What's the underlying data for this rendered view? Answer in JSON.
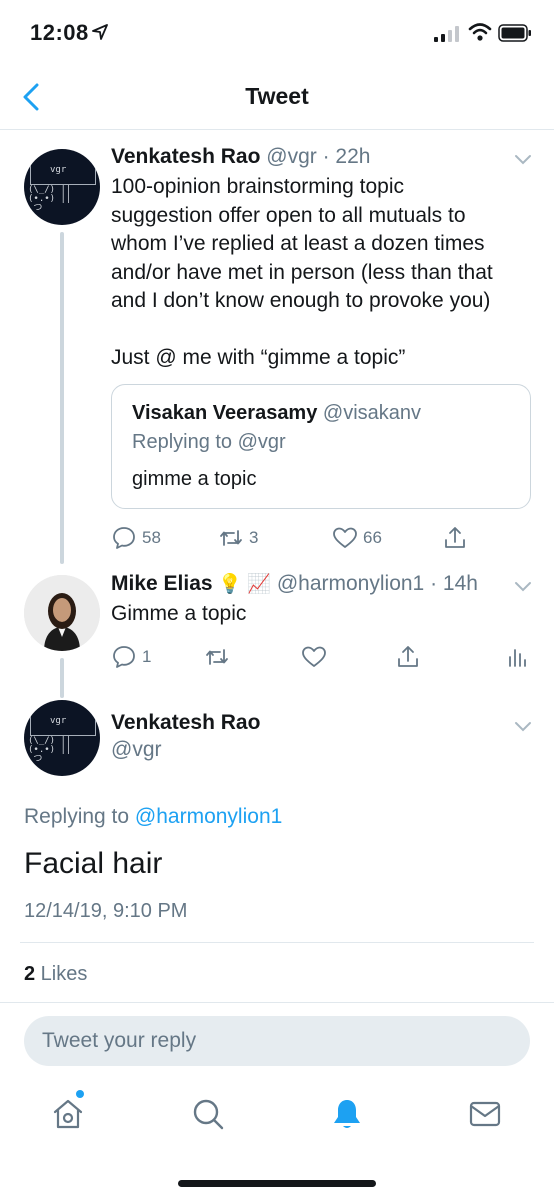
{
  "status": {
    "time": "12:08"
  },
  "nav": {
    "title": "Tweet"
  },
  "tweet1": {
    "name": "Venkatesh Rao",
    "handle_time": "@vgr · 22h",
    "avatar_text": "vgr",
    "lines": [
      "100-opinion brainstorming topic",
      "suggestion offer open to all mutuals to",
      "whom I’ve replied at least a dozen times",
      "and/or have met in person (less than that",
      "and I don’t know enough to provoke you)"
    ],
    "last_line": "Just @ me with “gimme a topic”",
    "quote": {
      "name": "Visakan Veerasamy",
      "handle": "@visakanv",
      "replying": "Replying to @vgr",
      "text": "gimme a topic"
    },
    "replies": "58",
    "retweets": "3",
    "likes": "66"
  },
  "tweet2": {
    "name": "Mike Elias",
    "emoji": "💡 📈",
    "handle_time": "@harmonylion1 · 14h",
    "text": "Gimme a topic",
    "replies": "1"
  },
  "main": {
    "name": "Venkatesh Rao",
    "handle": "@vgr",
    "avatar_text": "vgr",
    "replying_prefix": "Replying to ",
    "replying_handle": "@harmonylion1",
    "text": "Facial hair",
    "timestamp": "12/14/19, 9:10 PM",
    "likes_count": "2",
    "likes_label": " Likes"
  },
  "composer": {
    "placeholder": "Tweet your reply"
  },
  "colors": {
    "accent": "#1da1f2",
    "secondary_text": "#657786",
    "divider": "#e1e8ed"
  },
  "tabs": [
    "home-icon",
    "search-icon",
    "notifications-icon",
    "messages-icon"
  ]
}
